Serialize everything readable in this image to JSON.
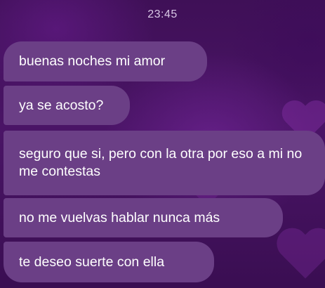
{
  "chat": {
    "timestamp": "23:45",
    "bubble_color": "#6b3f86",
    "background_color": "#3a0f52",
    "messages": [
      {
        "text": "buenas noches mi amor"
      },
      {
        "text": "ya se acosto?"
      },
      {
        "text": "seguro que si, pero con la otra por eso a mi no me contestas"
      },
      {
        "text": "no me vuelvas hablar nunca más"
      },
      {
        "text": "te deseo suerte con ella"
      }
    ]
  }
}
